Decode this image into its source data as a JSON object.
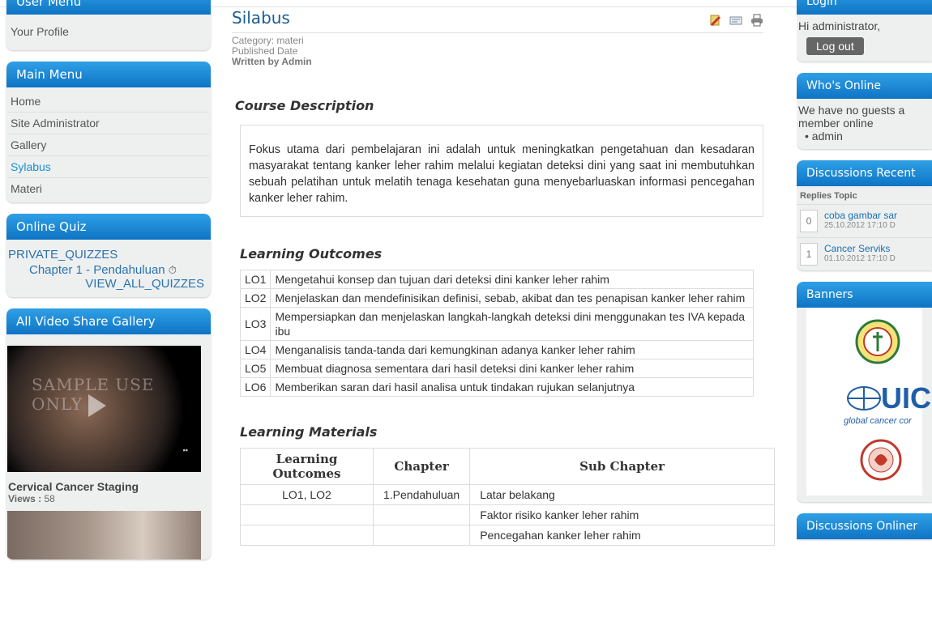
{
  "left": {
    "user_menu": {
      "title": "User Menu",
      "items": [
        "Your Profile"
      ]
    },
    "main_menu": {
      "title": "Main Menu",
      "items": [
        "Home",
        "Site Administrator",
        "Gallery",
        "Sylabus",
        "Materi"
      ],
      "active": "Sylabus"
    },
    "online_quiz": {
      "title": "Online Quiz",
      "private": "PRIVATE_QUIZZES",
      "chapter": "Chapter 1 - Pendahuluan",
      "view_all": "VIEW_ALL_QUIZZES"
    },
    "video": {
      "title": "All Video Share Gallery",
      "watermark": "SAMPLE USE ONLY",
      "video_title": "Cervical Cancer Staging",
      "views_label": "Views :",
      "views": "58"
    }
  },
  "article": {
    "title": "Silabus",
    "category": "Category: materi",
    "published": "Published Date",
    "written": "Written by Admin",
    "course_desc_title": "Course Description",
    "course_desc": "Fokus utama dari pembelajaran ini adalah untuk meningkatkan pengetahuan dan kesadaran masyarakat tentang kanker leher rahim melalui kegiatan deteksi dini yang saat ini membutuhkan sebuah pelatihan untuk melatih tenaga kesehatan guna menyebarluaskan informasi pencegahan kanker leher rahim.",
    "outcomes_title": "Learning Outcomes",
    "outcomes": [
      {
        "code": "LO1",
        "text": "Mengetahui konsep dan tujuan dari deteksi dini kanker leher rahim"
      },
      {
        "code": "LO2",
        "text": "Menjelaskan dan mendefinisikan definisi, sebab, akibat dan tes penapisan kanker   leher rahim"
      },
      {
        "code": "LO3",
        "text": "Mempersiapkan dan menjelaskan langkah-langkah deteksi dini menggunakan tes IVA kepada ibu"
      },
      {
        "code": "LO4",
        "text": "Menganalisis tanda-tanda dari kemungkinan adanya kanker leher rahim"
      },
      {
        "code": "LO5",
        "text": "Membuat diagnosa sementara dari hasil deteksi dini kanker leher rahim"
      },
      {
        "code": "LO6",
        "text": "Memberikan saran dari hasil analisa untuk tindakan rujukan selanjutnya"
      }
    ],
    "materials_title": "Learning Materials",
    "materials_headers": [
      "Learning Outcomes",
      "Chapter",
      "Sub Chapter"
    ],
    "materials": [
      {
        "lo": "LO1, LO2",
        "chapter": "1.Pendahuluan",
        "sub": "Latar belakang"
      },
      {
        "lo": "",
        "chapter": "",
        "sub": "Faktor risiko kanker leher rahim"
      },
      {
        "lo": "",
        "chapter": "",
        "sub": "Pencegahan kanker leher rahim"
      }
    ]
  },
  "right": {
    "login": {
      "title": "Login",
      "greeting": "Hi administrator,",
      "logout": "Log out"
    },
    "whos_online": {
      "title": "Who's Online",
      "text": "We have no guests a",
      "text2": "member online",
      "member": "admin"
    },
    "discussions": {
      "title": "Discussions Recent",
      "header": "Replies Topic",
      "items": [
        {
          "count": "0",
          "title": "coba gambar sar",
          "date": "25.10.2012 17:10  D"
        },
        {
          "count": "1",
          "title": "Cancer Serviks",
          "date": "01.10.2012 17:10  D"
        }
      ]
    },
    "banners": {
      "title": "Banners",
      "uicc_text": "UICC",
      "uicc_sub": "global cancer cor"
    },
    "discussions_online": {
      "title": "Discussions Onliner"
    }
  }
}
